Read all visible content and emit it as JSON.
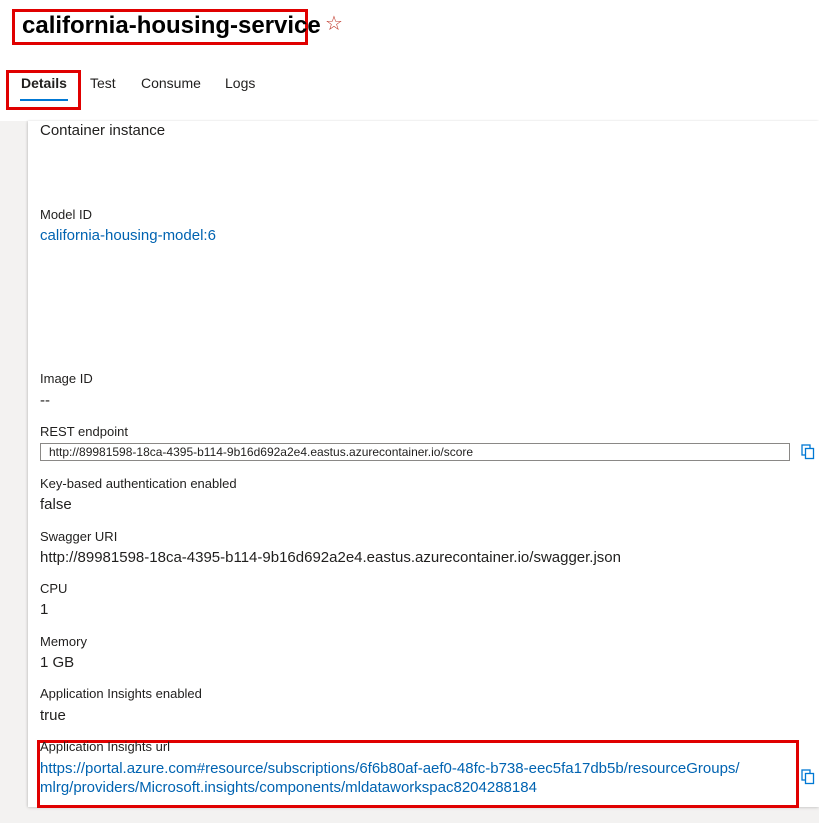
{
  "header": {
    "title": "california-housing-service",
    "star_icon": "star-icon"
  },
  "tabs": [
    {
      "label": "Details",
      "active": true
    },
    {
      "label": "Test",
      "active": false
    },
    {
      "label": "Consume",
      "active": false
    },
    {
      "label": "Logs",
      "active": false
    }
  ],
  "details": {
    "compute_type_value": "Container instance",
    "model_id": {
      "label": "Model ID",
      "value": "california-housing-model:6"
    },
    "image_id": {
      "label": "Image ID",
      "value": "--"
    },
    "rest_endpoint": {
      "label": "REST endpoint",
      "value": "http://89981598-18ca-4395-b114-9b16d692a2e4.eastus.azurecontainer.io/score"
    },
    "key_auth": {
      "label": "Key-based authentication enabled",
      "value": "false"
    },
    "swagger_uri": {
      "label": "Swagger URI",
      "value": "http://89981598-18ca-4395-b114-9b16d692a2e4.eastus.azurecontainer.io/swagger.json"
    },
    "cpu": {
      "label": "CPU",
      "value": "1"
    },
    "memory": {
      "label": "Memory",
      "value": "1 GB"
    },
    "app_insights_enabled": {
      "label": "Application Insights enabled",
      "value": "true"
    },
    "app_insights_url": {
      "label": "Application Insights url",
      "line1": "https://portal.azure.com#resource/subscriptions/6f6b80af-aef0-48fc-b738-eec5fa17db5b/resourceGroups/",
      "line2": "mlrg/providers/Microsoft.insights/components/mldataworkspac8204288184"
    }
  },
  "colors": {
    "accent": "#0078d4",
    "link": "#0063b1",
    "highlight": "#e00000"
  }
}
